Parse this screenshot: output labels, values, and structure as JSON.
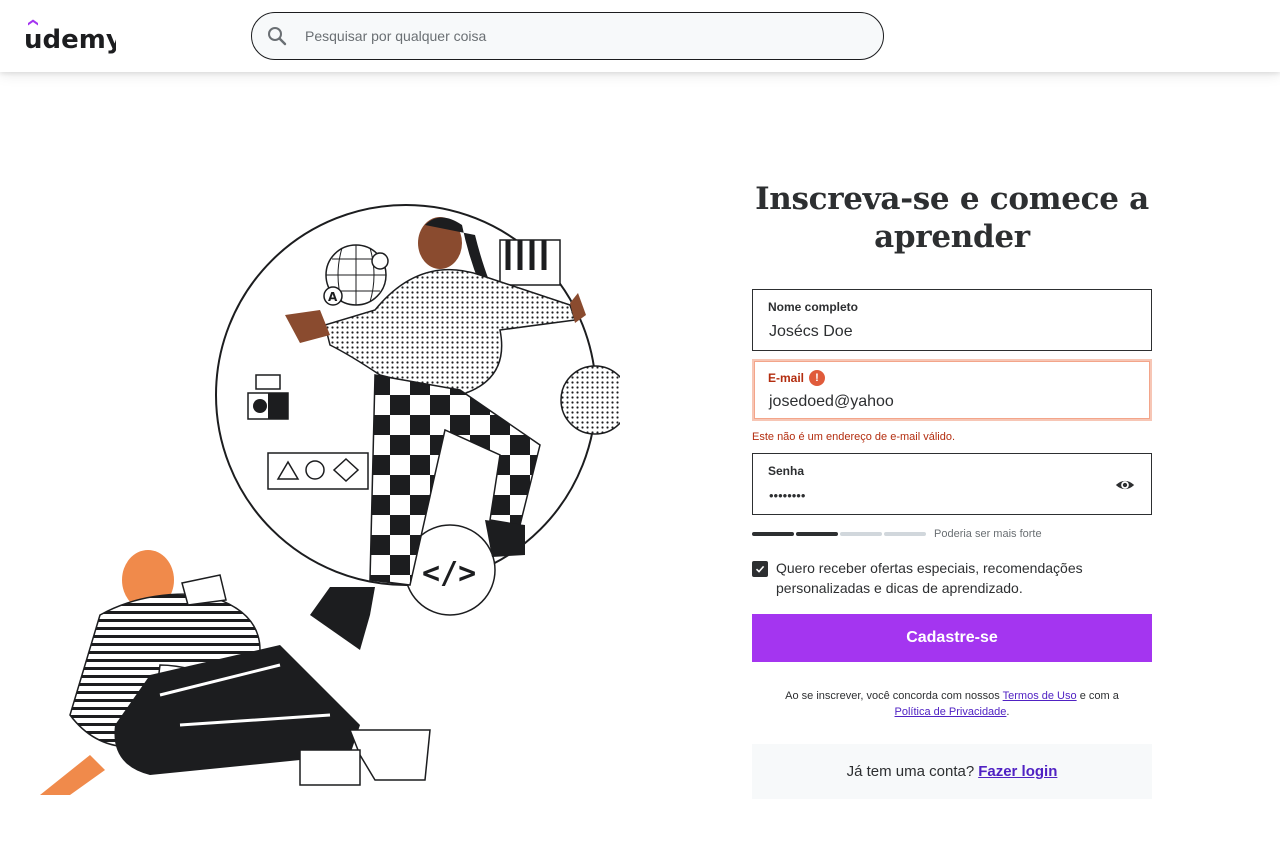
{
  "header": {
    "logo_text": "udemy",
    "search_placeholder": "Pesquisar por qualquer coisa"
  },
  "form": {
    "title": "Inscreva-se e comece a aprender",
    "name_field": {
      "label": "Nome completo",
      "value": "Josécs Doe"
    },
    "email_field": {
      "label": "E-mail",
      "value": "josedoed@yahoo",
      "error_icon": "!",
      "error_message": "Este não é um endereço de e-mail válido."
    },
    "password_field": {
      "label": "Senha",
      "value": "••••••••",
      "toggle_icon": "eye-icon"
    },
    "password_strength": {
      "filled_bars": 2,
      "total_bars": 4,
      "text": "Poderia ser mais forte"
    },
    "offers_checkbox": {
      "checked": true,
      "label": "Quero receber ofertas especiais, recomendações personalizadas e dicas de aprendizado."
    },
    "submit_label": "Cadastre-se",
    "terms": {
      "prefix": "Ao se inscrever, você concorda com nossos",
      "terms_link": "Termos de Uso",
      "middle": "e com a",
      "privacy_link": "Política de Privacidade",
      "suffix": "."
    },
    "login": {
      "prompt": "Já tem uma conta?",
      "link": "Fazer login"
    }
  },
  "colors": {
    "brand_purple": "#a435f0",
    "link_purple": "#5022c3",
    "error_red": "#b32d0f",
    "dark": "#2d2f31"
  }
}
